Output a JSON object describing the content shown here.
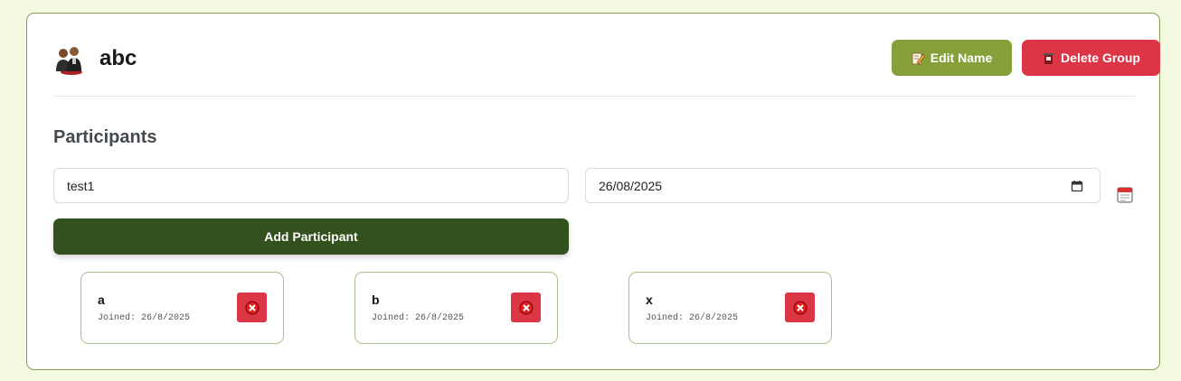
{
  "group": {
    "name": "abc",
    "icon": "group-people-icon"
  },
  "buttons": {
    "edit_label": "Edit Name",
    "edit_icon": "memo-pencil-icon",
    "delete_label": "Delete Group",
    "delete_icon": "trash-can-icon",
    "add_label": "Add Participant"
  },
  "participants_section": {
    "title": "Participants",
    "name_input_value": "test1",
    "date_input_value": "26/08/2025"
  },
  "participants": [
    {
      "name": "a",
      "joined": "Joined: 26/8/2025"
    },
    {
      "name": "b",
      "joined": "Joined: 26/8/2025"
    },
    {
      "name": "x",
      "joined": "Joined: 26/8/2025"
    }
  ],
  "colors": {
    "background": "#f4f9e2",
    "accent_olive": "#86a03a",
    "danger": "#dc3545",
    "primary_dark_green": "#33511d",
    "card_border": "#8aa04a"
  }
}
